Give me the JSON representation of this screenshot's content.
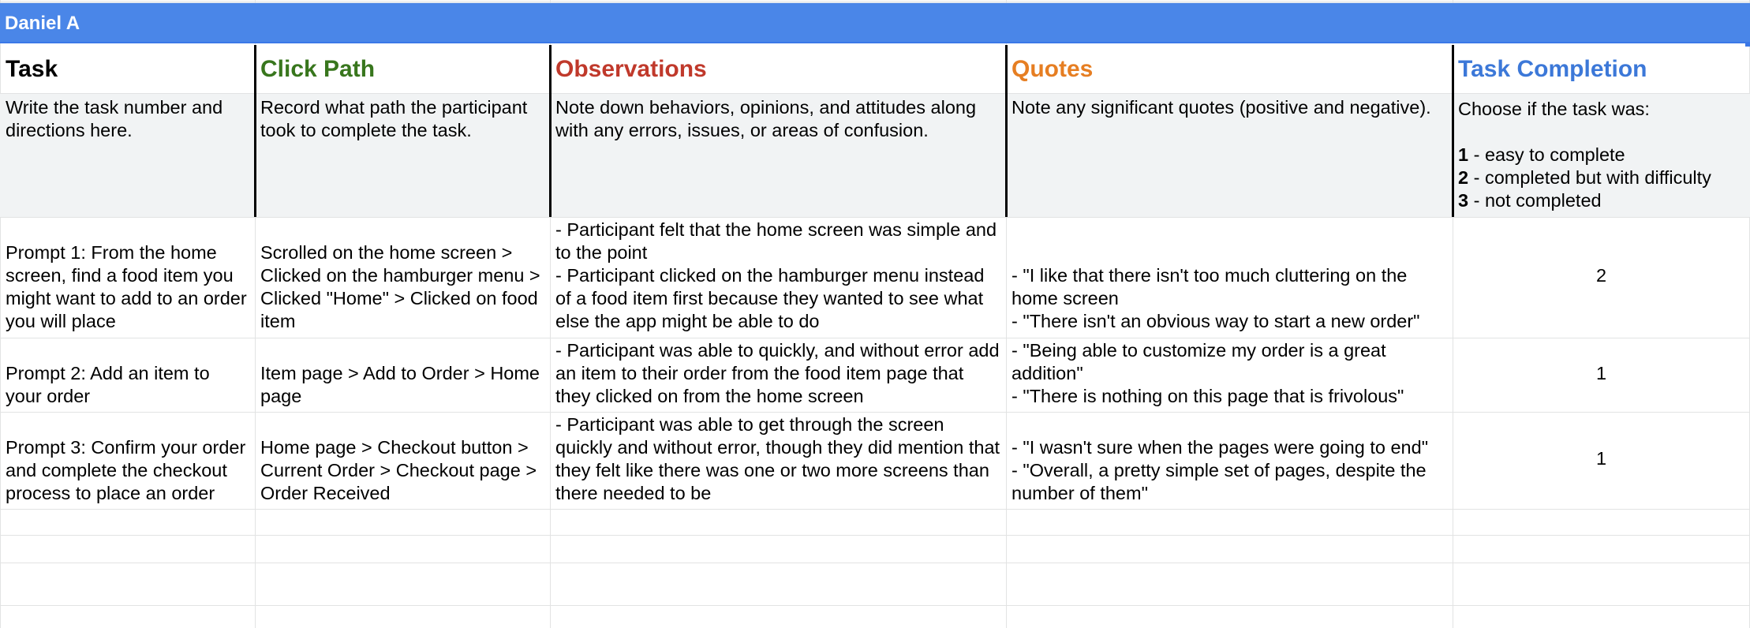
{
  "participant": "Daniel A",
  "colors": {
    "header_bar": "#4a86e8",
    "task": "#000000",
    "click_path": "#38761d",
    "observations": "#c0392b",
    "quotes": "#e67e22",
    "task_completion": "#3c78d8"
  },
  "columns": [
    {
      "title": "Task",
      "description": "Write the task number and directions here."
    },
    {
      "title": "Click Path",
      "description": "Record what path the participant took to complete the task."
    },
    {
      "title": "Observations",
      "description": "Note down behaviors, opinions, and attitudes along with any errors, issues, or areas of confusion."
    },
    {
      "title": "Quotes",
      "description": "Note any significant quotes (positive and negative)."
    },
    {
      "title": "Task Completion",
      "description_intro": "Choose if the task was:",
      "scale": [
        {
          "num": "1",
          "text": " - easy to complete"
        },
        {
          "num": "2",
          "text": " - completed but with difficulty"
        },
        {
          "num": "3",
          "text": " - not completed"
        }
      ]
    }
  ],
  "rows": [
    {
      "task": "Prompt 1: From the home screen, find a food item you might want to add to an order you will place",
      "click_path": "Scrolled on the home screen > Clicked on the hamburger menu > Clicked \"Home\" > Clicked on food item",
      "observations": "- Participant felt that the home screen was simple and to the point\n- Participant clicked on the hamburger menu instead of a food item first because they wanted to see what else the app might be able to do",
      "quotes": "- \"I like that there isn't too much cluttering on the home screen\n- \"There isn't an obvious way to start a new order\"",
      "completion": "2"
    },
    {
      "task": "Prompt 2: Add an item to your order",
      "click_path": "Item page > Add to Order > Home page",
      "observations": "- Participant was able to quickly, and without error add an item to their order from the food item page that they clicked on from the home screen",
      "quotes": "- \"Being able to customize my order is a great addition\"\n- \"There is nothing on this page that is frivolous\"",
      "completion": "1"
    },
    {
      "task": "Prompt 3: Confirm your order and complete the checkout process to place an order",
      "click_path": "Home page > Checkout button > Current Order > Checkout page > Order Received",
      "observations": "- Participant was able to get through the screen quickly and without error, though they did mention that they felt like there was one or two more screens than there needed to be",
      "quotes": "- \"I wasn't sure when the pages were going to end\"\n- \"Overall, a pretty simple set of pages, despite the number of them\"",
      "completion": "1"
    }
  ]
}
